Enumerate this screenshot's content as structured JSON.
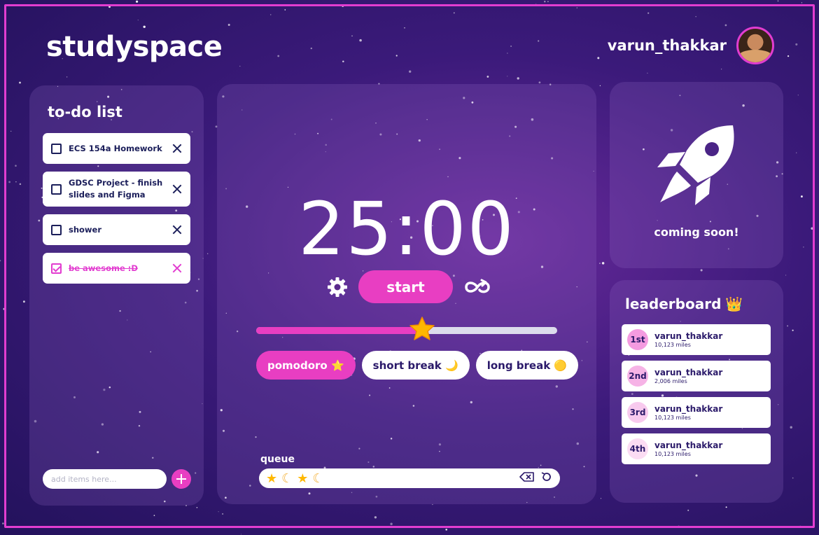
{
  "app": {
    "logo": "studyspace"
  },
  "user": {
    "name": "varun_thakkar",
    "avatar_icon": "avatar-photo"
  },
  "todo": {
    "title": "to-do list",
    "items": [
      {
        "label": "ECS 154a Homework",
        "checked": false
      },
      {
        "label": "GDSC Project - finish slides and Figma",
        "checked": false
      },
      {
        "label": "shower",
        "checked": false
      },
      {
        "label": "be awesome :D",
        "checked": true
      }
    ],
    "add_placeholder": "add items here...",
    "add_value": ""
  },
  "timer": {
    "time": "25:00",
    "start_label": "start",
    "progress": 0.55,
    "modes": [
      {
        "label": "pomodoro",
        "emoji": "⭐",
        "active": true
      },
      {
        "label": "short break",
        "emoji": "🌙",
        "active": false
      },
      {
        "label": "long break",
        "emoji": "🟡",
        "active": false
      }
    ],
    "queue_label": "queue",
    "queue": [
      "star",
      "moon",
      "star",
      "moon"
    ]
  },
  "rocket": {
    "label": "coming soon!"
  },
  "leaderboard": {
    "title": "leaderboard",
    "title_emoji": "👑",
    "rows": [
      {
        "rank": "1st",
        "name": "varun_thakkar",
        "miles": "10,123 miles"
      },
      {
        "rank": "2nd",
        "name": "varun_thakkar",
        "miles": "2,006 miles"
      },
      {
        "rank": "3rd",
        "name": "varun_thakkar",
        "miles": "10,123 miles"
      },
      {
        "rank": "4th",
        "name": "varun_thakkar",
        "miles": "10,123 miles"
      }
    ]
  },
  "colors": {
    "accent": "#e83ec2",
    "frame": "#e23dd0",
    "ink": "#1b1e5a"
  }
}
